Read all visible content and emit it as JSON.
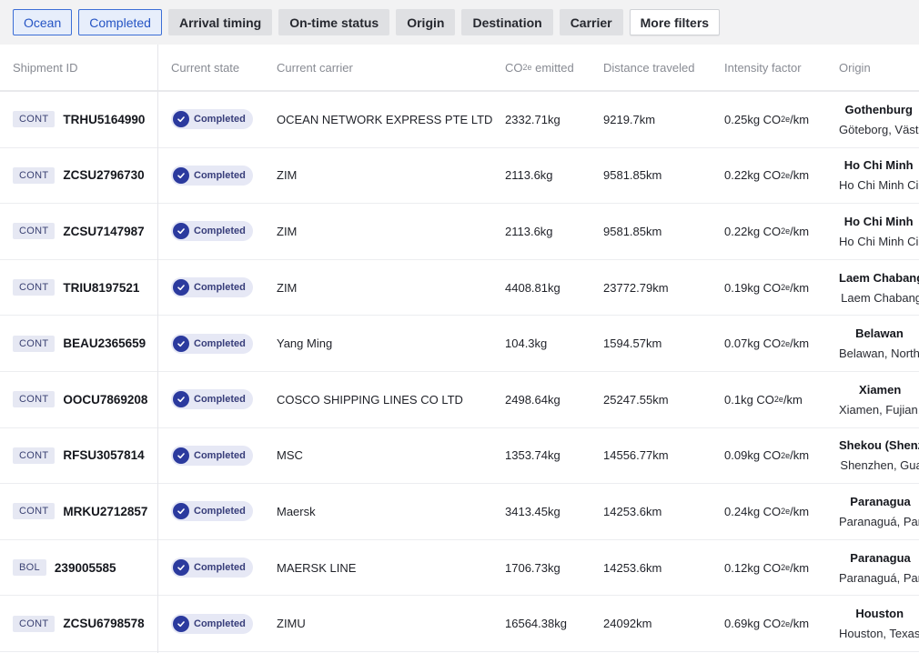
{
  "filters": [
    {
      "label": "Ocean",
      "style": "active"
    },
    {
      "label": "Completed",
      "style": "active"
    },
    {
      "label": "Arrival timing",
      "style": "plain"
    },
    {
      "label": "On-time status",
      "style": "plain"
    },
    {
      "label": "Origin",
      "style": "plain"
    },
    {
      "label": "Destination",
      "style": "plain"
    },
    {
      "label": "Carrier",
      "style": "plain"
    },
    {
      "label": "More filters",
      "style": "outline"
    }
  ],
  "columns": {
    "shipment_id": "Shipment ID",
    "current_state": "Current state",
    "current_carrier": "Current carrier",
    "co2_prefix": "CO",
    "co2_sub": "2e",
    "co2_suffix": " emitted",
    "distance": "Distance traveled",
    "intensity": "Intensity factor",
    "origin": "Origin"
  },
  "intensity_unit": {
    "prefix": "kg CO",
    "sub": "2e",
    "suffix": "/km"
  },
  "rows": [
    {
      "type": "CONT",
      "id": "TRHU5164990",
      "state": "Completed",
      "carrier": "OCEAN NETWORK EXPRESS PTE LTD",
      "co2": "2332.71kg",
      "distance": "9219.7km",
      "intensity": "0.25",
      "origin_city": "Gothenburg",
      "origin_region": "Göteborg, Väst"
    },
    {
      "type": "CONT",
      "id": "ZCSU2796730",
      "state": "Completed",
      "carrier": "ZIM",
      "co2": "2113.6kg",
      "distance": "9581.85km",
      "intensity": "0.22",
      "origin_city": "Ho Chi Minh",
      "origin_region": "Ho Chi Minh Ci"
    },
    {
      "type": "CONT",
      "id": "ZCSU7147987",
      "state": "Completed",
      "carrier": "ZIM",
      "co2": "2113.6kg",
      "distance": "9581.85km",
      "intensity": "0.22",
      "origin_city": "Ho Chi Minh",
      "origin_region": "Ho Chi Minh Ci"
    },
    {
      "type": "CONT",
      "id": "TRIU8197521",
      "state": "Completed",
      "carrier": "ZIM",
      "co2": "4408.81kg",
      "distance": "23772.79km",
      "intensity": "0.19",
      "origin_city": "Laem Chabang",
      "origin_region": "Laem Chabang"
    },
    {
      "type": "CONT",
      "id": "BEAU2365659",
      "state": "Completed",
      "carrier": "Yang Ming",
      "co2": "104.3kg",
      "distance": "1594.57km",
      "intensity": "0.07",
      "origin_city": "Belawan",
      "origin_region": "Belawan, North"
    },
    {
      "type": "CONT",
      "id": "OOCU7869208",
      "state": "Completed",
      "carrier": "COSCO SHIPPING LINES CO LTD",
      "co2": "2498.64kg",
      "distance": "25247.55km",
      "intensity": "0.1",
      "origin_city": "Xiamen",
      "origin_region": "Xiamen, Fujian,"
    },
    {
      "type": "CONT",
      "id": "RFSU3057814",
      "state": "Completed",
      "carrier": "MSC",
      "co2": "1353.74kg",
      "distance": "14556.77km",
      "intensity": "0.09",
      "origin_city": "Shekou (Shenz",
      "origin_region": "Shenzhen, Gua"
    },
    {
      "type": "CONT",
      "id": "MRKU2712857",
      "state": "Completed",
      "carrier": "Maersk",
      "co2": "3413.45kg",
      "distance": "14253.6km",
      "intensity": "0.24",
      "origin_city": "Paranagua",
      "origin_region": "Paranaguá, Par"
    },
    {
      "type": "BOL",
      "id": "239005585",
      "state": "Completed",
      "carrier": "MAERSK LINE",
      "co2": "1706.73kg",
      "distance": "14253.6km",
      "intensity": "0.12",
      "origin_city": "Paranagua",
      "origin_region": "Paranaguá, Par"
    },
    {
      "type": "CONT",
      "id": "ZCSU6798578",
      "state": "Completed",
      "carrier": "ZIMU",
      "co2": "16564.38kg",
      "distance": "24092km",
      "intensity": "0.69",
      "origin_city": "Houston",
      "origin_region": "Houston, Texas"
    }
  ],
  "colors": {
    "accent": "#2b3a9e",
    "active_chip": "#3c6ed6",
    "filter_bg": "#f2f2f3"
  }
}
